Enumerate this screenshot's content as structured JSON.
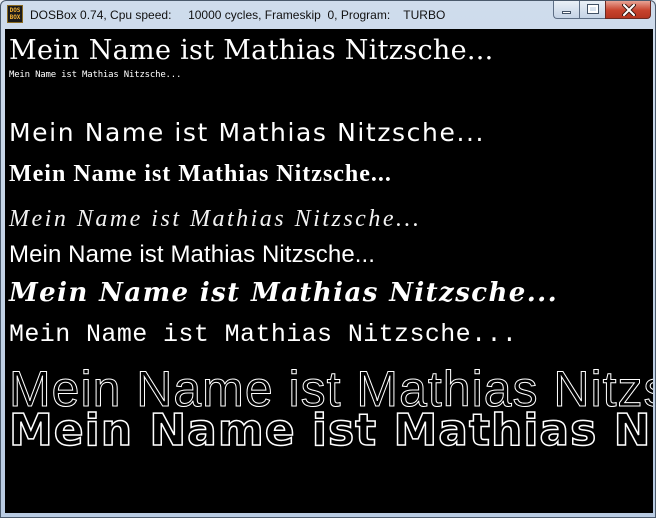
{
  "window": {
    "title": "DOSBox 0.74, Cpu speed:     10000 cycles, Frameskip  0, Program:    TURBO",
    "icon_label": "DOS BOX",
    "icon": "dosbox-icon",
    "controls": {
      "minimize_icon": "minimize-icon",
      "maximize_icon": "maximize-icon",
      "close_icon": "close-icon"
    }
  },
  "screen": {
    "background": "#000000",
    "text_color": "#ffffff",
    "lines": [
      "Mein Name ist Mathias Nitzsche...",
      "Mein Name ist Mathias Nitzsche...",
      "Mein Name ist Mathias Nitzsche...",
      "Mein Name ist Mathias Nitzsche...",
      "Mein Name ist Mathias Nitzsche...",
      "Mein Name ist Mathias Nitzsche...",
      "Mein Name ist Mathias Nitzsche...",
      "Mein Name ist Mathias Nitzsche...",
      "Mein Name ist Mathias Nitzsche...",
      "Mein Name ist Mathias Nitzsche..."
    ]
  }
}
